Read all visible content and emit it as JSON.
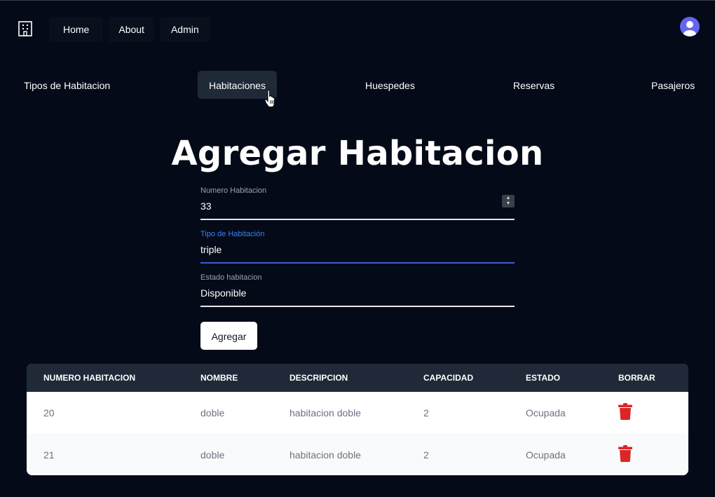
{
  "topnav": {
    "items": [
      {
        "label": "Home"
      },
      {
        "label": "About"
      },
      {
        "label": "Admin"
      }
    ]
  },
  "subnav": {
    "items": [
      {
        "label": "Tipos de Habitacion",
        "active": false
      },
      {
        "label": "Habitaciones",
        "active": true
      },
      {
        "label": "Huespedes",
        "active": false
      },
      {
        "label": "Reservas",
        "active": false
      },
      {
        "label": "Pasajeros",
        "active": false
      }
    ]
  },
  "form": {
    "title": "Agregar Habitacion",
    "numero": {
      "label": "Numero Habitacion",
      "value": "33"
    },
    "tipo": {
      "label": "Tipo de Habitación",
      "value": "triple"
    },
    "estado": {
      "label": "Estado habitacion",
      "value": "Disponible"
    },
    "submit_label": "Agregar"
  },
  "table": {
    "headers": [
      "NUMERO HABITACION",
      "NOMBRE",
      "DESCRIPCION",
      "CAPACIDAD",
      "ESTADO",
      "BORRAR"
    ],
    "rows": [
      [
        "20",
        "doble",
        "habitacion doble",
        "2",
        "Ocupada"
      ],
      [
        "21",
        "doble",
        "habitacion doble",
        "2",
        "Ocupada"
      ]
    ]
  },
  "colors": {
    "background": "#050a18",
    "header_bg": "#1f2937",
    "accent": "#3b5bdb",
    "avatar": "#6366f1",
    "delete": "#dc2626"
  },
  "icons": {
    "logo": "building-icon",
    "avatar": "user-icon",
    "delete": "trash-icon",
    "cursor": "hand-cursor-icon",
    "stepper": "chevron-up-down-icon"
  }
}
